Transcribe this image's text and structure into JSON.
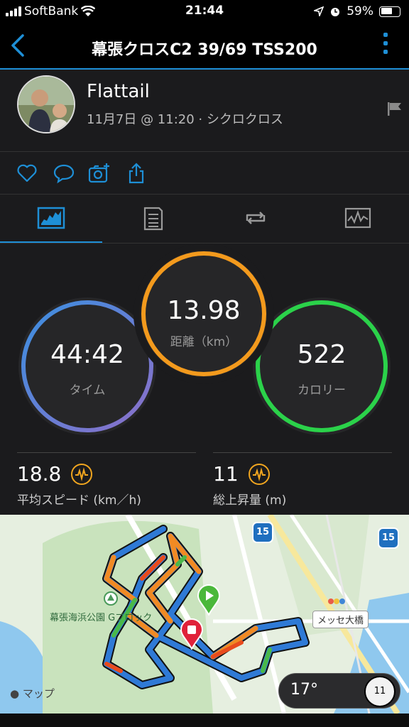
{
  "status_bar": {
    "carrier": "SoftBank",
    "time": "21:44",
    "battery": "59%"
  },
  "nav": {
    "title": "幕張クロスC2 39/69 TSS200"
  },
  "profile": {
    "name": "Flattail",
    "subtitle": "11月7日 @ 11:20 · シクロクロス"
  },
  "summary": {
    "time": {
      "value": "44:42",
      "label": "タイム"
    },
    "distance": {
      "value": "13.98",
      "label": "距離（km）"
    },
    "calories": {
      "value": "522",
      "label": "カロリー"
    }
  },
  "stats": {
    "avg_speed": {
      "value": "18.8",
      "label": "平均スピード (km／h)"
    },
    "elevation": {
      "value": "11",
      "label": "総上昇量 (m)"
    }
  },
  "map": {
    "park_label": "幕張海浜公園 Gブロック",
    "bridge_label": "メッセ大橋",
    "route_shield": "15",
    "attribution": "マップ"
  },
  "weather": {
    "temperature": "17°",
    "wind": "11"
  },
  "colors": {
    "accent": "#1e8fd6",
    "time_ring": "#3a8fd9",
    "distance_ring": "#f39a1d",
    "calorie_ring": "#2bd24a"
  }
}
